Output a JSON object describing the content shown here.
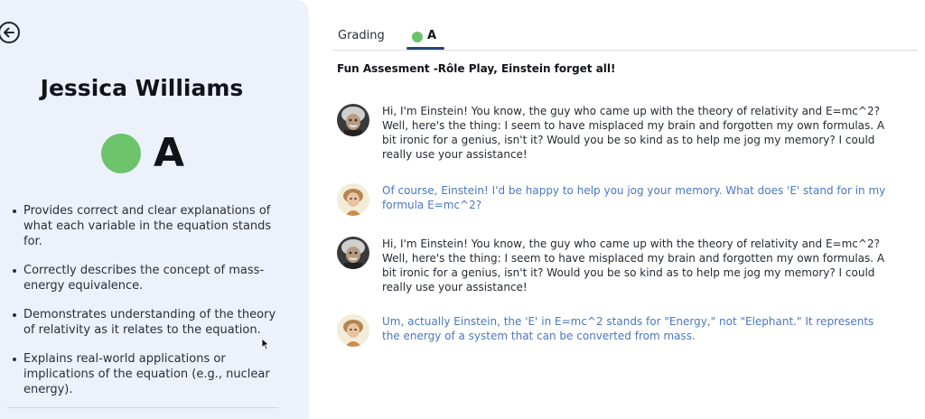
{
  "student": {
    "name": "Jessica Williams",
    "grade": "A",
    "grade_color": "#6cc36a"
  },
  "criteria": [
    "Provides correct and clear explanations of what each variable in the equation stands for.",
    "Correctly describes the concept of mass-energy equivalence.",
    "Demonstrates understanding of the theory of relativity as it relates to the equation.",
    "Explains real-world applications or implications of the equation (e.g., nuclear energy)."
  ],
  "tabs": {
    "grading_label": "Grading",
    "grade_label": "A"
  },
  "assessment": {
    "title": "Fun Assesment -Rôle Play, Einstein forget all!"
  },
  "messages": [
    {
      "role": "einstein",
      "text": "Hi, I'm Einstein! You know, the guy who came up with the theory of relativity and E=mc^2? Well, here's the thing: I seem to have misplaced my brain and forgotten my own formulas. A bit ironic for a genius, isn't it? Would you be so kind as to help me jog my memory? I could really use your assistance!"
    },
    {
      "role": "student",
      "text": "Of course, Einstein! I'd be happy to help you jog your memory. What does 'E' stand for in my formula E=mc^2?"
    },
    {
      "role": "einstein",
      "text": "Hi, I'm Einstein! You know, the guy who came up with the theory of relativity and E=mc^2? Well, here's the thing: I seem to have misplaced my brain and forgotten my own formulas. A bit ironic for a genius, isn't it? Would you be so kind as to help me jog my memory? I could really use your assistance!"
    },
    {
      "role": "student",
      "text": "Um, actually Einstein, the 'E' in E=mc^2 stands for \"Energy,\" not \"Elephant.\" It represents the energy of a system that can be converted from mass."
    }
  ],
  "colors": {
    "accent": "#26467a",
    "student_text": "#4a78c0",
    "panel_bg": "#edf1fa"
  },
  "icons": {
    "back": "arrow-left-circle-icon",
    "cursor": "mouse-pointer-icon"
  }
}
